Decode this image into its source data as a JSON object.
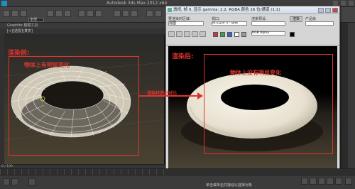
{
  "app": {
    "title": "Autodesk 3ds Max 2012 x64",
    "ribbon_label": "Graphite 建模工具",
    "viewport_label": "[+][透视][真实]",
    "toolbar_dropdown": "全部"
  },
  "annotations": {
    "before_label": "渲染前:",
    "after_label": "渲染后:",
    "object_changed": "物体上有明显变化",
    "object_unchanged": "物体上没有明显变化",
    "arrow_text": "渲染材质后对比"
  },
  "render_window": {
    "title": "透视, 帧 0, 显示 gamma: 2.2, RGBA 颜色 16 位/通道 (1:1)",
    "area_label": "要渲染的区域:",
    "area_value": "视图",
    "viewport_label": "视口:",
    "viewport_value": "四元菜单 4 - 透视",
    "preset_label": "渲染预设:",
    "preset_value": "",
    "render_button": "渲染",
    "product_label": "产品级",
    "channel_label": "RGB Alpha"
  },
  "timeline": {
    "frame_counter": "0 / 100"
  },
  "status": {
    "text": "单击或单击并拖动以选择对象"
  },
  "colors": {
    "annotation_red": "#e0332d"
  }
}
